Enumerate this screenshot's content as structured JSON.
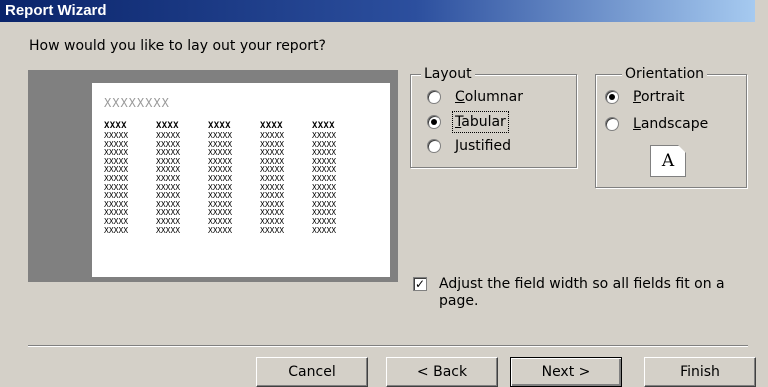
{
  "window": {
    "title": "Report Wizard"
  },
  "question": "How would you like to lay out your report?",
  "preview": {
    "heading": "XXXXXXXX",
    "column_headers": [
      "XXXX",
      "XXXX",
      "XXXX",
      "XXXX",
      "XXXX"
    ],
    "cell_placeholder": "XXXXX",
    "rows": 12
  },
  "layout": {
    "legend": "Layout",
    "options": [
      {
        "label": "Columnar",
        "accelerator": "C",
        "selected": false
      },
      {
        "label": "Tabular",
        "accelerator": "T",
        "selected": true
      },
      {
        "label": "Justified",
        "accelerator": "J",
        "selected": false
      }
    ]
  },
  "orientation": {
    "legend": "Orientation",
    "options": [
      {
        "label": "Portrait",
        "accelerator": "P",
        "selected": true
      },
      {
        "label": "Landscape",
        "accelerator": "L",
        "selected": false
      }
    ],
    "icon_letter": "A"
  },
  "adjust_width": {
    "checked": true,
    "label": "Adjust the field width so all fields fit on a page."
  },
  "buttons": {
    "cancel": "Cancel",
    "back": "< Back",
    "next": "Next >",
    "finish": "Finish"
  }
}
